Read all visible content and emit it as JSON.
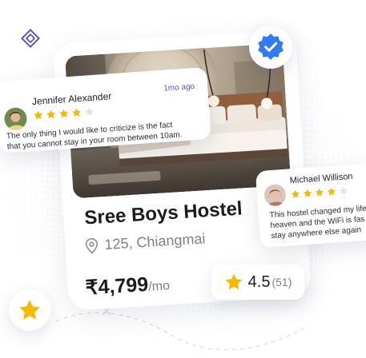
{
  "listing": {
    "title": "Sree Boys Hostel",
    "location": "125, Chiangmai",
    "price": "₹4,799",
    "price_unit": "/mo",
    "rating": "4.5",
    "rating_count": "(51)"
  },
  "reviews": [
    {
      "name": "Jennifer Alexander",
      "time": "1mo ago",
      "stars": 4,
      "lines": [
        "The only thing I would like to criticize is the fact",
        "that you cannot stay in your room between 10am."
      ]
    },
    {
      "name": "Michael Willison",
      "stars": 4,
      "lines": [
        "This hostel changed my life",
        "heaven and the WiFi is fas",
        "stay anywhere else again"
      ]
    }
  ],
  "colors": {
    "accent": "#2f7bf5",
    "star": "#f6b800",
    "star_empty": "#e3e3e8",
    "time": "#5b53c9"
  },
  "icons": [
    "diamond-icon",
    "verified-check-icon",
    "location-pin-icon",
    "star-icon"
  ]
}
